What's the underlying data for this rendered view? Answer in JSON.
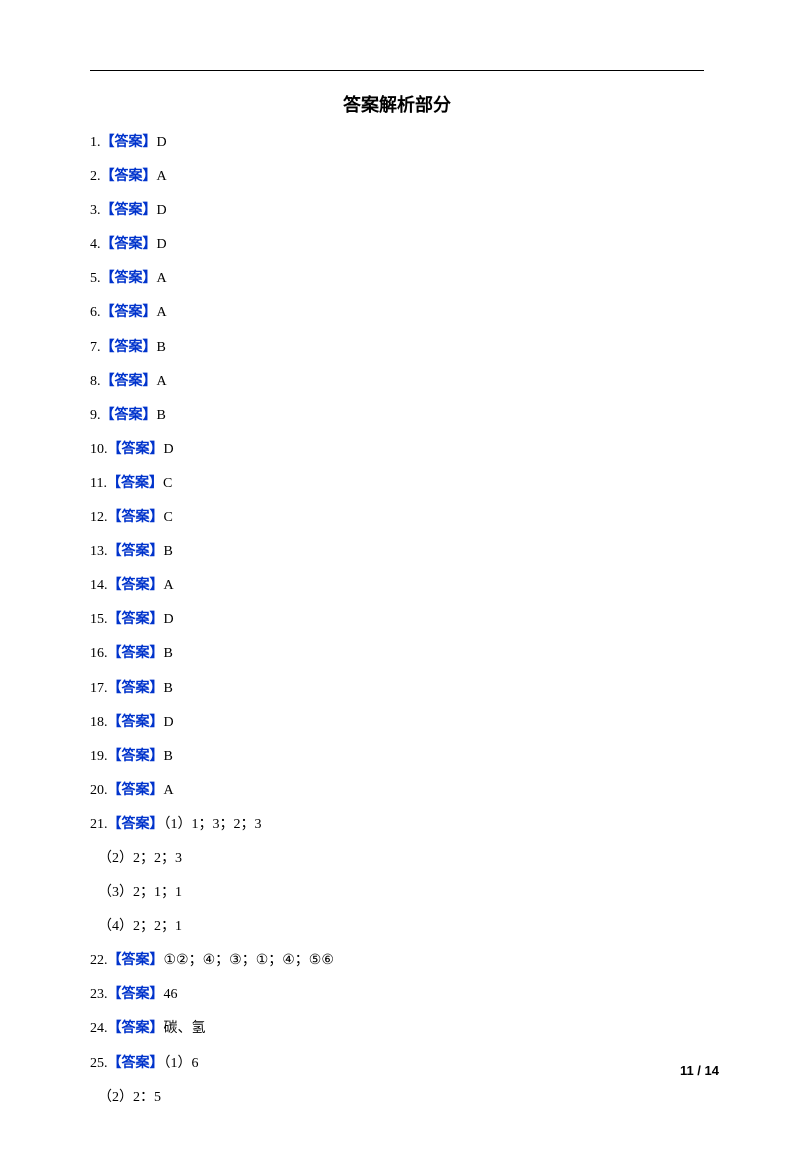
{
  "title": "答案解析部分",
  "answerLabel": "【答案】",
  "answers": [
    {
      "num": "1.",
      "value": "D"
    },
    {
      "num": "2.",
      "value": "A"
    },
    {
      "num": "3.",
      "value": "D"
    },
    {
      "num": "4.",
      "value": "D"
    },
    {
      "num": "5.",
      "value": "A"
    },
    {
      "num": "6.",
      "value": "A"
    },
    {
      "num": "7.",
      "value": "B"
    },
    {
      "num": "8.",
      "value": "A"
    },
    {
      "num": "9.",
      "value": "B"
    },
    {
      "num": "10.",
      "value": "D"
    },
    {
      "num": "11.",
      "value": "C"
    },
    {
      "num": "12.",
      "value": "C"
    },
    {
      "num": "13.",
      "value": "B"
    },
    {
      "num": "14.",
      "value": "A"
    },
    {
      "num": "15.",
      "value": "D"
    },
    {
      "num": "16.",
      "value": "B"
    },
    {
      "num": "17.",
      "value": "B"
    },
    {
      "num": "18.",
      "value": "D"
    },
    {
      "num": "19.",
      "value": "B"
    },
    {
      "num": "20.",
      "value": "A"
    }
  ],
  "q21": {
    "num": "21.",
    "part1": "（1）1；3；2；3",
    "subs": [
      "（2）2；2；3",
      "（3）2；1；1",
      "（4）2；2；1"
    ]
  },
  "q22": {
    "num": "22.",
    "value": "①②；④；③；①；④；⑤⑥"
  },
  "q23": {
    "num": "23.",
    "value": "46"
  },
  "q24": {
    "num": "24.",
    "value": "碳、氢"
  },
  "q25": {
    "num": "25.",
    "part1": "（1）6",
    "subs": [
      "（2）2：5"
    ]
  },
  "footer": {
    "page": "11",
    "sep": " / ",
    "total": "14"
  }
}
